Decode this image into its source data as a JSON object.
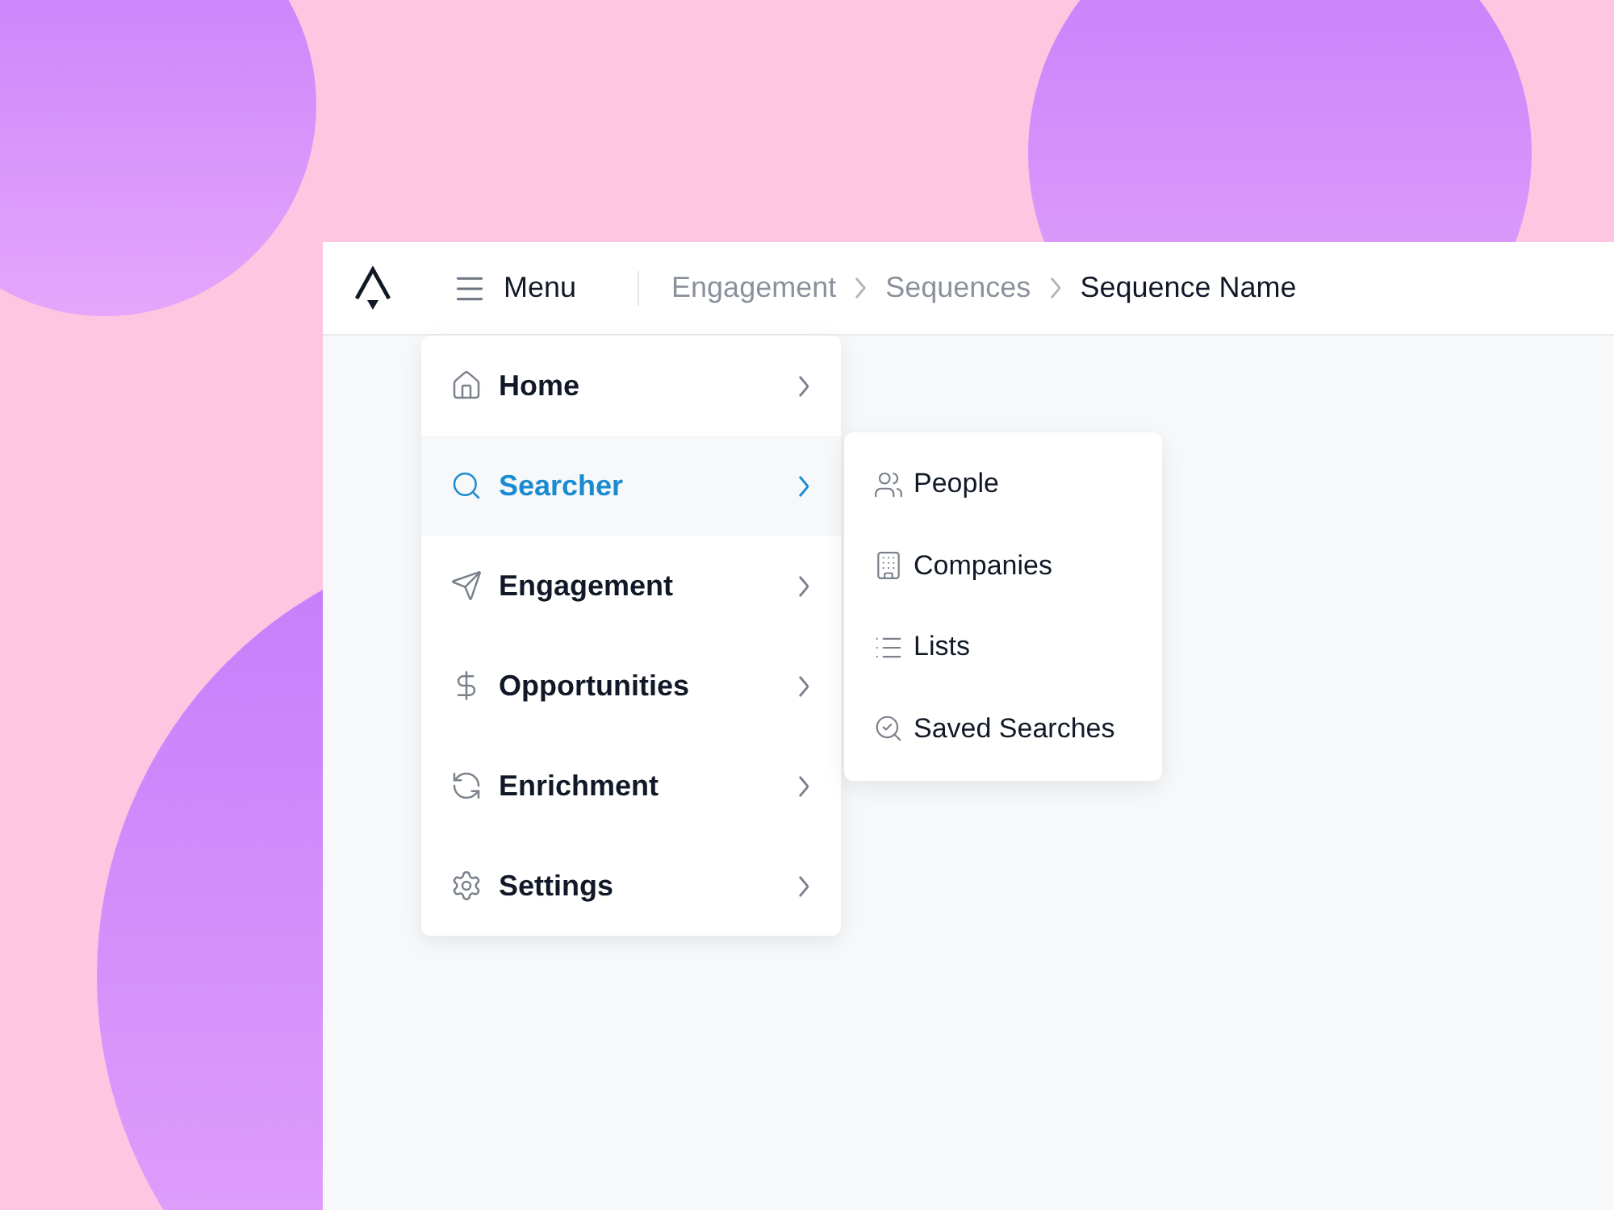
{
  "header": {
    "menu_button": "Menu",
    "breadcrumbs": [
      {
        "label": "Engagement",
        "current": false
      },
      {
        "label": "Sequences",
        "current": false
      },
      {
        "label": "Sequence Name",
        "current": true
      }
    ]
  },
  "menu": {
    "items": [
      {
        "label": "Home",
        "selected": false
      },
      {
        "label": "Searcher",
        "selected": true
      },
      {
        "label": "Engagement",
        "selected": false
      },
      {
        "label": "Opportunities",
        "selected": false
      },
      {
        "label": "Enrichment",
        "selected": false
      },
      {
        "label": "Settings",
        "selected": false
      }
    ]
  },
  "submenu": {
    "items": [
      {
        "label": "People"
      },
      {
        "label": "Companies"
      },
      {
        "label": "Lists"
      },
      {
        "label": "Saved Searches"
      }
    ]
  }
}
